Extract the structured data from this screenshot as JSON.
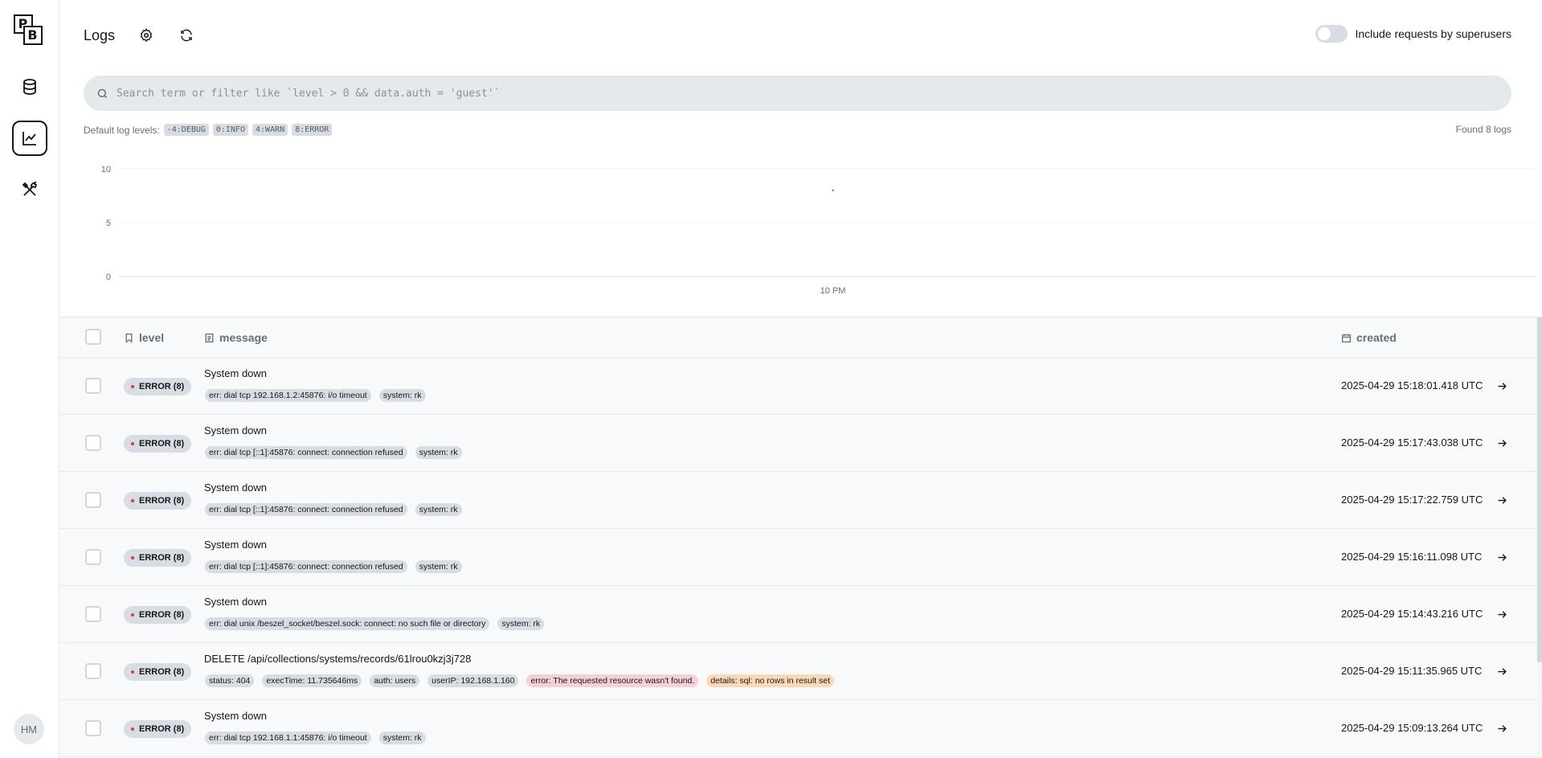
{
  "sidebar": {
    "logo": {
      "p": "P",
      "b": "B"
    },
    "nav": [
      {
        "name": "collections",
        "icon": "database-icon"
      },
      {
        "name": "logs",
        "icon": "chart-line-icon",
        "active": true
      },
      {
        "name": "settings",
        "icon": "tools-icon"
      }
    ],
    "avatar_initials": "HM"
  },
  "header": {
    "title": "Logs",
    "settings_icon": "gear-icon",
    "refresh_icon": "refresh-icon",
    "toggle_label": "Include requests by superusers",
    "toggle_on": false
  },
  "search": {
    "placeholder": "Search term or filter like `level > 0 && data.auth = 'guest'`",
    "value": ""
  },
  "levels": {
    "label": "Default log levels:",
    "items": [
      "-4:DEBUG",
      "0:INFO",
      "4:WARN",
      "8:ERROR"
    ]
  },
  "found_text": "Found 8 logs",
  "chart_data": {
    "type": "line",
    "x": [
      "10 PM"
    ],
    "series": [
      {
        "values": [
          8
        ]
      }
    ],
    "ylim": [
      0,
      10
    ],
    "y_ticks": [
      "0",
      "5",
      "10"
    ],
    "x_ticks": [
      "10 PM"
    ],
    "grid": true,
    "accent": "#e13756"
  },
  "table": {
    "headers": {
      "level": "level",
      "message": "message",
      "created": "created"
    },
    "rows": [
      {
        "level": "ERROR (8)",
        "message": "System down",
        "tags": [
          {
            "text": "err: dial tcp 192.168.1.2:45876: i/o timeout",
            "kind": "default"
          },
          {
            "text": "system: rk",
            "kind": "default"
          }
        ],
        "created": "2025-04-29 15:18:01.418 UTC"
      },
      {
        "level": "ERROR (8)",
        "message": "System down",
        "tags": [
          {
            "text": "err: dial tcp [::1]:45876: connect: connection refused",
            "kind": "default"
          },
          {
            "text": "system: rk",
            "kind": "default"
          }
        ],
        "created": "2025-04-29 15:17:43.038 UTC"
      },
      {
        "level": "ERROR (8)",
        "message": "System down",
        "tags": [
          {
            "text": "err: dial tcp [::1]:45876: connect: connection refused",
            "kind": "default"
          },
          {
            "text": "system: rk",
            "kind": "default"
          }
        ],
        "created": "2025-04-29 15:17:22.759 UTC"
      },
      {
        "level": "ERROR (8)",
        "message": "System down",
        "tags": [
          {
            "text": "err: dial tcp [::1]:45876: connect: connection refused",
            "kind": "default"
          },
          {
            "text": "system: rk",
            "kind": "default"
          }
        ],
        "created": "2025-04-29 15:16:11.098 UTC"
      },
      {
        "level": "ERROR (8)",
        "message": "System down",
        "tags": [
          {
            "text": "err: dial unix /beszel_socket/beszel.sock: connect: no such file or directory",
            "kind": "default"
          },
          {
            "text": "system: rk",
            "kind": "default"
          }
        ],
        "created": "2025-04-29 15:14:43.216 UTC"
      },
      {
        "level": "ERROR (8)",
        "message": "DELETE /api/collections/systems/records/61lrou0kzj3j728",
        "tags": [
          {
            "text": "status: 404",
            "kind": "default"
          },
          {
            "text": "execTime: 11.735646ms",
            "kind": "default"
          },
          {
            "text": "auth: users",
            "kind": "default"
          },
          {
            "text": "userIP: 192.168.1.160",
            "kind": "default"
          },
          {
            "text": "error: The requested resource wasn't found.",
            "kind": "danger"
          },
          {
            "text": "details: sql: no rows in result set",
            "kind": "warning"
          }
        ],
        "created": "2025-04-29 15:11:35.965 UTC"
      },
      {
        "level": "ERROR (8)",
        "message": "System down",
        "tags": [
          {
            "text": "err: dial tcp 192.168.1.1:45876: i/o timeout",
            "kind": "default"
          },
          {
            "text": "system: rk",
            "kind": "default"
          }
        ],
        "created": "2025-04-29 15:09:13.264 UTC"
      }
    ]
  }
}
